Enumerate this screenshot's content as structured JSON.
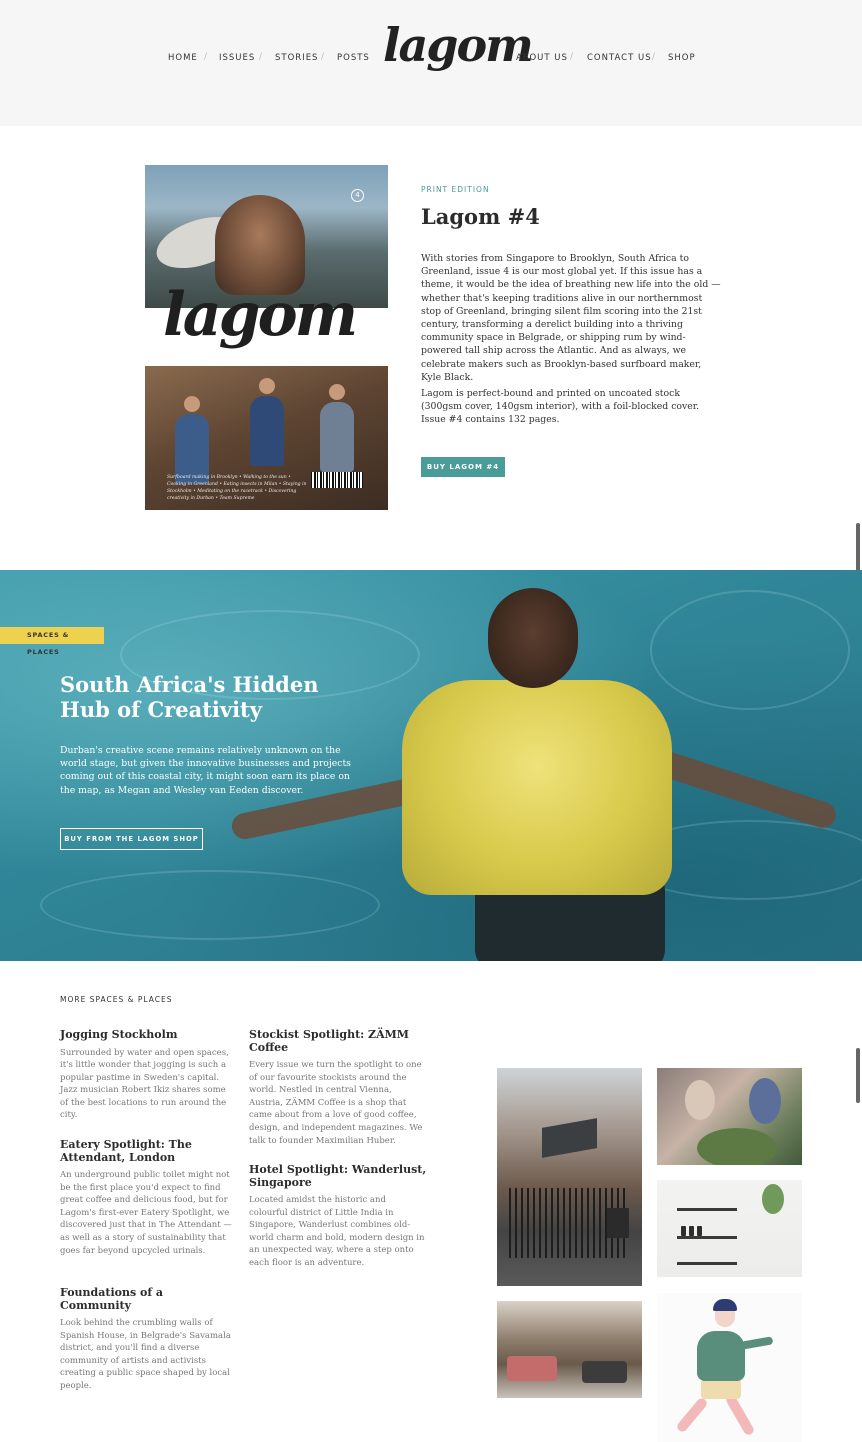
{
  "header": {
    "logo": "lagom",
    "nav_left": [
      "HOME",
      "ISSUES",
      "STORIES",
      "POSTS"
    ],
    "nav_right": [
      "ABOUT US",
      "CONTACT US",
      "SHOP"
    ],
    "separator": "/"
  },
  "product": {
    "eyebrow": "PRINT EDITION",
    "title": "Lagom #4",
    "description": "With stories from Singapore to Brooklyn, South Africa to Greenland, issue 4 is our most global yet. If this issue has a theme, it would be the idea of breathing new life into the old — whether that's keeping traditions alive in our northernmost stop of Greenland, bringing silent film scoring into the 21st century, transforming a derelict building into a thriving community space in Belgrade, or shipping rum by wind-powered tall ship across the Atlantic. And as always, we celebrate makers such as Brooklyn-based surfboard maker, Kyle Black.",
    "spec": "Lagom is perfect-bound and printed on uncoated stock (300gsm cover, 140gsm interior), with a foil-blocked cover. Issue #4 contains 132 pages.",
    "buy_label": "BUY LAGOM #4",
    "cover": {
      "logo": "lagom",
      "issue_badge": "4",
      "blurb": "Surfboard making in Brooklyn • Walking to the sun • Cooking in Greenland • Eating insects in Milan • Staying in Stockholm • Meditating on the racetrack • Discovering creativity in Durban • Team Supreme"
    }
  },
  "hero": {
    "tag": "SPACES & PLACES",
    "title": "South Africa's Hidden Hub of Creativity",
    "description": "Durban's creative scene remains relatively unknown on the world stage, but given the innovative businesses and projects coming out of this coastal city, it might soon earn its place on the map, as Megan and Wesley van Eeden discover.",
    "button_label": "BUY FROM THE LAGOM SHOP"
  },
  "more": {
    "heading": "MORE SPACES & PLACES",
    "articles": [
      {
        "title": "Jogging Stockholm",
        "description": "Surrounded by water and open spaces, it's little wonder that jogging is such a popular pastime in Sweden's capital. Jazz musician Robert Ikiz shares some of the best locations to run around the city."
      },
      {
        "title": "Eatery Spotlight: The Attendant, London",
        "description": "An underground public toilet might not be the first place you'd expect to find great coffee and delicious food, but for Lagom's first-ever Eatery Spotlight, we discovered just that in The Attendant — as well as a story of sustainability that goes far beyond upcycled urinals."
      },
      {
        "title": "Foundations of a Community",
        "description": "Look behind the crumbling walls of Spanish House, in Belgrade's Savamala district, and you'll find a diverse community of artists and activists creating a public space shaped by local people."
      },
      {
        "title": "Stockist Spotlight: ZÄMM Coffee",
        "description": "Every issue we turn the spotlight to one of our favourite stockists around the world. Nestled in central Vienna, Austria, ZÄMM Coffee is a shop that came about from a love of good coffee, design, and independent magazines. We talk to founder Maximilian Huber."
      },
      {
        "title": "Hotel Spotlight: Wanderlust, Singapore",
        "description": "Located amidst the historic and colourful district of Little India in Singapore, Wanderlust combines old-world charm and bold, modern design in an unexpected way, where a step onto each floor is an adventure."
      }
    ]
  },
  "colors": {
    "accent_teal": "#4a9c98",
    "tag_yellow": "#ecd24f",
    "header_bg": "#f6f6f6"
  }
}
